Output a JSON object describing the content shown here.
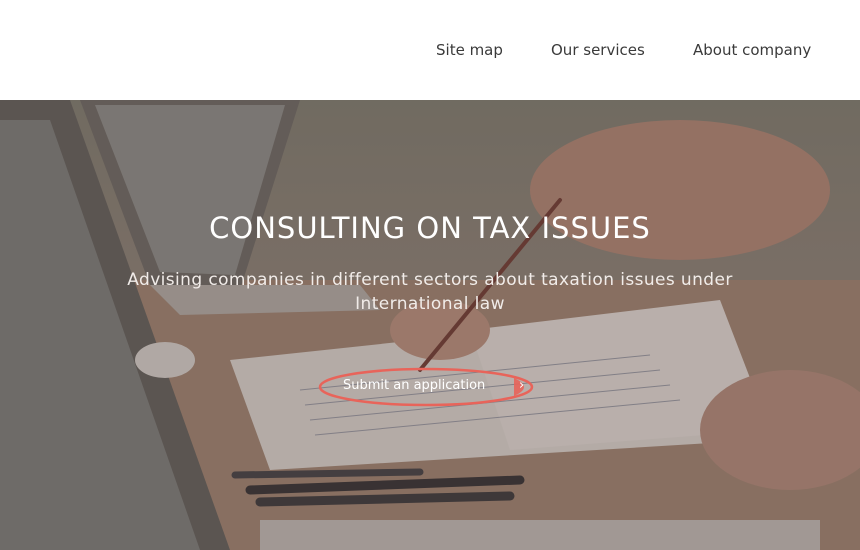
{
  "nav": {
    "items": [
      {
        "label": "Site map"
      },
      {
        "label": "Our services"
      },
      {
        "label": "About company"
      }
    ]
  },
  "hero": {
    "title": "CONSULTING ON TAX ISSUES",
    "subtitle": "Advising companies in different sectors about taxation issues under International law",
    "cta_label": "Submit an application",
    "cta_icon": "chevron-right-icon"
  },
  "colors": {
    "cta_accent": "#e8645a",
    "nav_text": "#3a3a3a",
    "hero_text": "#ffffff"
  }
}
